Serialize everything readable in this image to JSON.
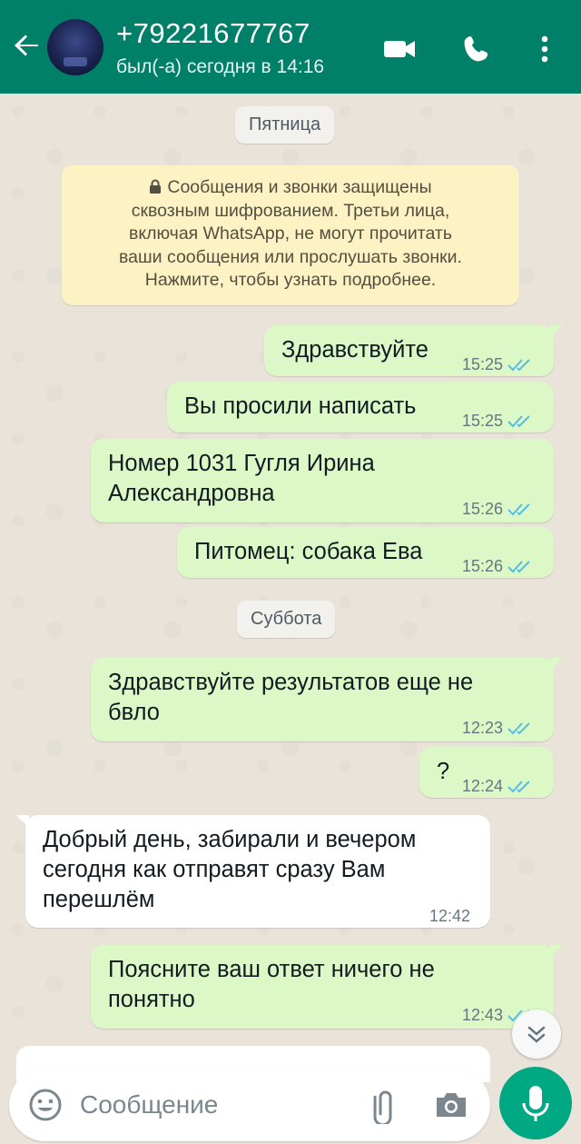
{
  "header": {
    "contact_name": "+79221677767",
    "status": "был(-а) сегодня в 14:16",
    "icons": [
      "back-arrow-icon",
      "video-call-icon",
      "voice-call-icon",
      "more-options-icon"
    ]
  },
  "chat": {
    "date_friday": "Пятница",
    "encryption_notice": "Сообщения и звонки защищены сквозным шифрованием. Третьи лица, включая WhatsApp, не могут прочитать ваши сообщения или прослушать звонки. Нажмите, чтобы узнать подробнее.",
    "encryption_lines": [
      "Сообщения и звонки защищены",
      "сквозным шифрованием. Третьи лица,",
      "включая WhatsApp, не могут прочитать",
      "ваши сообщения или прослушать звонки.",
      "Нажмите, чтобы узнать подробнее."
    ],
    "date_saturday": "Суббота",
    "messages": [
      {
        "direction": "out",
        "text": "Здравствуйте",
        "time": "15:25",
        "status": "read"
      },
      {
        "direction": "out",
        "text": "Вы просили написать",
        "time": "15:25",
        "status": "read"
      },
      {
        "direction": "out",
        "text": "Номер 1031 Гугля Ирина Александровна",
        "lines": [
          "Номер 1031 Гугля Ирина",
          "Александровна"
        ],
        "time": "15:26",
        "status": "read"
      },
      {
        "direction": "out",
        "text": "Питомец: собака Ева",
        "time": "15:26",
        "status": "read"
      },
      {
        "direction": "out",
        "text": "Здравствуйте результатов еще не бвло",
        "lines": [
          "Здравствуйте результатов еще не",
          "бвло"
        ],
        "time": "12:23",
        "status": "read"
      },
      {
        "direction": "out",
        "text": "?",
        "time": "12:24",
        "status": "read"
      },
      {
        "direction": "in",
        "text": "Добрый день, забирали и вечером сегодня как отправят сразу Вам перешлём",
        "lines": [
          "Добрый день, забирали и вечером",
          "сегодня как отправят сразу Вам",
          "перешлём"
        ],
        "time": "12:42"
      },
      {
        "direction": "out",
        "text": "Поясните ваш ответ ничего не понятно",
        "lines": [
          "Поясните ваш ответ ничего не",
          "понятно"
        ],
        "time": "12:43",
        "status": "read"
      }
    ]
  },
  "composer": {
    "placeholder": "Сообщение",
    "icons": [
      "emoji-icon",
      "attach-icon",
      "camera-icon",
      "mic-icon"
    ]
  },
  "colors": {
    "header": "#008069",
    "outgoing_bubble": "#dcf8c6",
    "incoming_bubble": "#ffffff",
    "read_ticks": "#53bdeb",
    "mic_button": "#00a884"
  }
}
